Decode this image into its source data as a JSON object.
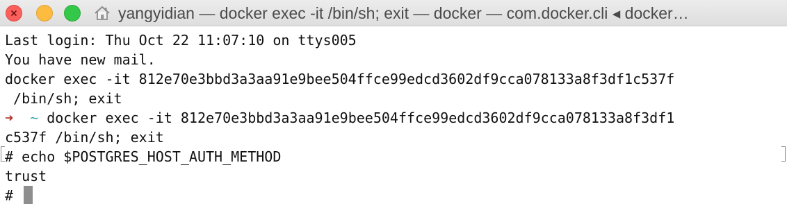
{
  "window": {
    "title": "yangyidian — docker exec -it  /bin/sh; exit — docker — com.docker.cli ◂ docker…",
    "controls": {
      "close_icon": "close-icon",
      "minimize_icon": "minimize-icon",
      "zoom_icon": "zoom-icon"
    },
    "title_icon": "home-icon"
  },
  "colors": {
    "close": "#fc605c",
    "minimize": "#fdbc40",
    "zoom": "#34c84a",
    "prompt_arrow": "#b0322a",
    "prompt_tilde": "#3aa6b9",
    "cursor": "#8e8e8e"
  },
  "terminal": {
    "lines": [
      "Last login: Thu Oct 22 11:07:10 on ttys005",
      "You have new mail.",
      "docker exec -it 812e70e3bbd3a3aa91e9bee504ffce99edcd3602df9cca078133a8f3df1c537f",
      " /bin/sh; exit"
    ],
    "prompt": {
      "arrow": "➜",
      "tilde": "~",
      "command_line1": " docker exec -it 812e70e3bbd3a3aa91e9bee504ffce99edcd3602df9cca078133a8f3df1",
      "command_line2": "c537f /bin/sh; exit"
    },
    "shell": {
      "echo_command": "# echo $POSTGRES_HOST_AUTH_METHOD",
      "output": "trust",
      "prompt": "# "
    }
  }
}
